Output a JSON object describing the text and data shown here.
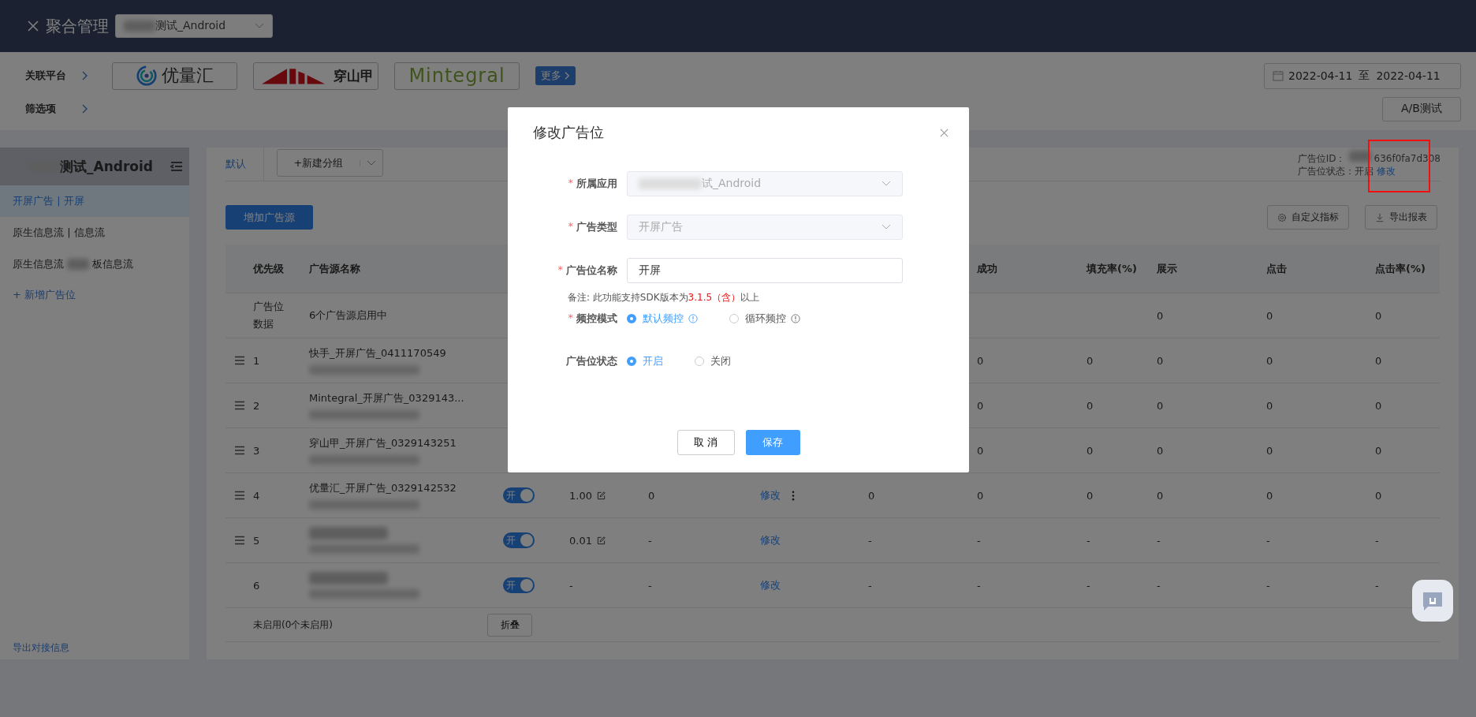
{
  "header": {
    "title": "聚合管理",
    "app_select": "测试_Android"
  },
  "platforms": {
    "label": "关联平台",
    "logos": [
      {
        "name": "优量汇",
        "kind": "rings"
      },
      {
        "name": "穿山甲",
        "kind": "bars"
      },
      {
        "name": "Mintegral",
        "kind": "plain"
      }
    ],
    "more": "更多"
  },
  "filter": {
    "label": "筛选项"
  },
  "date_range": {
    "start": "2022-04-11",
    "separator": "至",
    "end": "2022-04-11"
  },
  "ab_test": "A/B测试",
  "sidebar": {
    "app": "测试_Android",
    "items": [
      {
        "label": "开屏广告 | 开屏",
        "selected": true
      },
      {
        "label": "原生信息流 | 信息流",
        "selected": false
      },
      {
        "label": "原生信息流",
        "label_tail": "板信息流",
        "selected": false
      }
    ],
    "add": "+ 新增广告位",
    "export": "导出对接信息"
  },
  "tabs": [
    {
      "label": "默认",
      "selected": true
    }
  ],
  "new_group": "+新建分组",
  "placement_info": {
    "id_label": "广告位ID：",
    "id_value": "636f0fa7d308",
    "status_label": "广告位状态：",
    "status_value": "开启",
    "edit": "修改"
  },
  "add_source": "增加广告源",
  "toolbar": [
    {
      "label": "自定义指标",
      "kind": "gear"
    },
    {
      "label": "导出报表",
      "kind": "download"
    }
  ],
  "table": {
    "columns": [
      "优先级",
      "广告源名称",
      "成功",
      "填充率(%)",
      "展示",
      "点击",
      "点击率(%)"
    ],
    "summary": {
      "label": "广告位数据",
      "text": "6个广告源启用中",
      "metrics_tail": [
        "0",
        "0",
        "0"
      ]
    },
    "rows": [
      {
        "priority": "1",
        "draggable": true,
        "name": "快手_开屏广告_0411170549",
        "metrics": [
          "0",
          "0",
          "0",
          "0",
          "0"
        ]
      },
      {
        "priority": "2",
        "draggable": true,
        "name": "Mintegral_开屏广告_0329143...",
        "metrics": [
          "0",
          "0",
          "0",
          "0",
          "0"
        ]
      },
      {
        "priority": "3",
        "draggable": true,
        "name": "穿山甲_开屏广告_0329143251",
        "metrics": [
          "0",
          "0",
          "0",
          "0",
          "0"
        ]
      },
      {
        "priority": "4",
        "draggable": true,
        "name": "优量汇_开屏广告_0329142532",
        "status": {
          "label": "开",
          "on": true
        },
        "price": "1.00",
        "price_editable": true,
        "column_5": "0",
        "action": "修改",
        "action_more": true,
        "column_7": "0",
        "metrics": [
          "0",
          "0",
          "0",
          "0",
          "0"
        ]
      },
      {
        "priority": "5",
        "draggable": true,
        "status": {
          "label": "开",
          "on": true
        },
        "price": "0.01",
        "price_editable": true,
        "column_5": "-",
        "action": "修改",
        "action_more": false,
        "column_7": "-",
        "metrics": [
          "-",
          "-",
          "-",
          "-",
          "-"
        ]
      },
      {
        "priority": "6",
        "draggable": false,
        "status": {
          "label": "开",
          "on": true
        },
        "price": "-",
        "price_editable": false,
        "column_5": "-",
        "action": "修改",
        "action_more": false,
        "column_7": "-",
        "metrics": [
          "-",
          "-",
          "-",
          "-",
          "-"
        ]
      }
    ],
    "footer": {
      "text": "未启用(0个未启用)",
      "collapse": "折叠"
    }
  },
  "modal": {
    "title": "修改广告位",
    "required_mark": "*",
    "fields": [
      {
        "label": "所属应用",
        "required": true,
        "kind": "select",
        "value": "试_Android",
        "disabled": true
      },
      {
        "label": "广告类型",
        "required": true,
        "kind": "select",
        "value": "开屏广告",
        "disabled": true
      },
      {
        "label": "广告位名称",
        "required": true,
        "kind": "input",
        "value": "开屏",
        "disabled": false
      }
    ],
    "note": {
      "text": "备注: 此功能支持SDK版本为",
      "highlight": "3.1.5（含）",
      "tail": "以上"
    },
    "radio_groups": [
      {
        "label": "频控模式",
        "required": true,
        "options": [
          {
            "label": "默认频控",
            "selected": true,
            "info": true
          },
          {
            "label": "循环频控",
            "selected": false,
            "info": true
          }
        ]
      },
      {
        "label": "广告位状态",
        "required": false,
        "options": [
          {
            "label": "开启",
            "selected": true,
            "info": false
          },
          {
            "label": "关闭",
            "selected": false,
            "info": false
          }
        ]
      }
    ],
    "cancel": "取 消",
    "save": "保存"
  }
}
